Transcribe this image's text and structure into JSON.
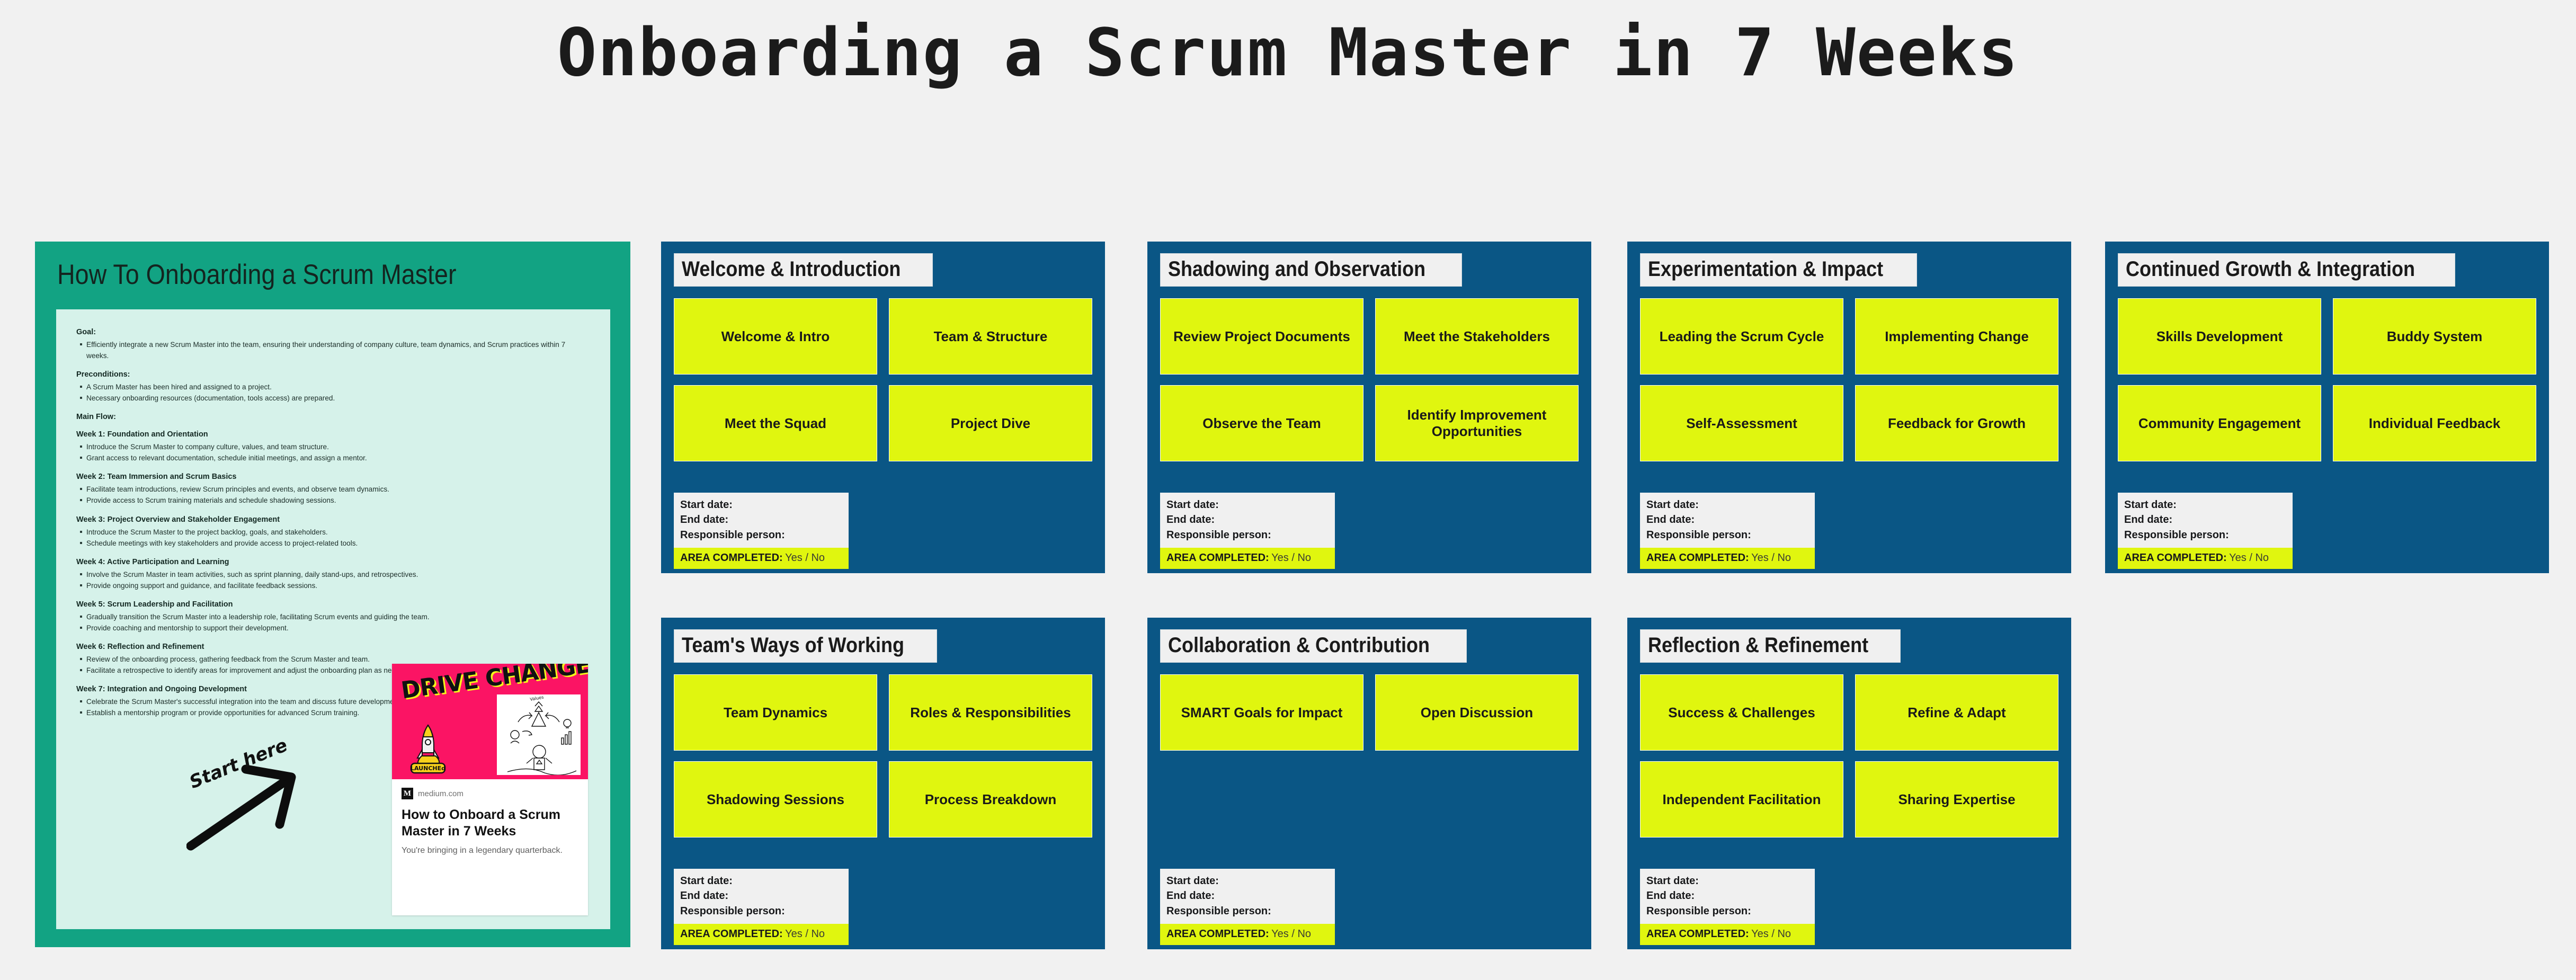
{
  "page": {
    "title": "Onboarding a Scrum Master in 7 Weeks",
    "background_color": "#f1f1f1"
  },
  "colors": {
    "teal": "#12a383",
    "mint": "#d6f2ea",
    "blue": "#0a5685",
    "yellow": "#e0f60f",
    "pink": "#fb1464"
  },
  "doc_panel": {
    "header_title": "How To Onboarding a Scrum Master",
    "sections": [
      {
        "heading": "Goal:",
        "items": [
          "Efficiently integrate a new Scrum Master into the team, ensuring their understanding of company culture, team dynamics, and Scrum practices within 7 weeks."
        ]
      },
      {
        "heading": "Preconditions:",
        "items": [
          "A Scrum Master has been hired and assigned to a project.",
          "Necessary onboarding resources (documentation, tools access) are prepared."
        ]
      },
      {
        "heading": "Main Flow:",
        "items": []
      },
      {
        "heading": "Week 1: Foundation and Orientation",
        "items": [
          "Introduce the Scrum Master to company culture, values, and team structure.",
          "Grant access to relevant documentation, schedule initial meetings, and assign a mentor."
        ]
      },
      {
        "heading": "Week 2: Team Immersion and Scrum Basics",
        "items": [
          "Facilitate team introductions, review Scrum principles and events, and observe team dynamics.",
          "Provide access to Scrum training materials and schedule shadowing sessions."
        ]
      },
      {
        "heading": "Week 3: Project Overview and Stakeholder Engagement",
        "items": [
          "Introduce the Scrum Master to the project backlog, goals, and stakeholders.",
          "Schedule meetings with key stakeholders and provide access to project-related tools."
        ]
      },
      {
        "heading": "Week 4: Active Participation and Learning",
        "items": [
          "Involve the Scrum Master in team activities, such as sprint planning, daily stand-ups, and retrospectives.",
          "Provide ongoing support and guidance, and facilitate feedback sessions."
        ]
      },
      {
        "heading": "Week 5: Scrum Leadership and Facilitation",
        "items": [
          "Gradually transition the Scrum Master into a leadership role, facilitating Scrum events and guiding the team.",
          "Provide coaching and mentorship to support their development."
        ]
      },
      {
        "heading": "Week 6: Reflection and Refinement",
        "items": [
          "Review of the onboarding process, gathering feedback from the Scrum Master and team.",
          "Facilitate a retrospective to identify areas for improvement and adjust the onboarding plan as needed."
        ]
      },
      {
        "heading": "Week 7: Integration and Ongoing Development",
        "items": [
          "Celebrate the Scrum Master's successful integration into the team and discuss future development goals.",
          "Establish a mentorship program or provide opportunities for advanced Scrum training."
        ]
      }
    ]
  },
  "annotation": {
    "start_here_label": "Start here"
  },
  "preview_card": {
    "hero_title": "DRIVE CHANGE",
    "rocket_badge": "LAUNCHEd",
    "sketch_caption": "Values",
    "source_badge": "M",
    "source_name": "medium.com",
    "title": "How to Onboard a Scrum Master in 7 Weeks",
    "description": "You're bringing in a legendary quarterback."
  },
  "meta_labels": {
    "start_date": "Start date:",
    "end_date": "End date:",
    "responsible_person": "Responsible person:",
    "area_completed_label": "AREA COMPLETED:",
    "area_completed_value": "Yes / No"
  },
  "area_cards": [
    {
      "title": "Welcome & Introduction",
      "tiles": [
        "Welcome & Intro",
        "Team & Structure",
        "Meet the Squad",
        "Project Dive"
      ]
    },
    {
      "title": "Shadowing and Observation",
      "tiles": [
        "Review Project Documents",
        "Meet the Stakeholders",
        "Observe the Team",
        "Identify Improvement Opportunities"
      ]
    },
    {
      "title": "Experimentation & Impact",
      "tiles": [
        "Leading the Scrum Cycle",
        "Implementing Change",
        "Self-Assessment",
        "Feedback for Growth"
      ]
    },
    {
      "title": "Continued Growth & Integration",
      "tiles": [
        "Skills Development",
        "Buddy System",
        "Community Engagement",
        "Individual Feedback"
      ]
    },
    {
      "title": "Team's Ways of Working",
      "tiles": [
        "Team Dynamics",
        "Roles & Responsibilities",
        "Shadowing Sessions",
        "Process Breakdown"
      ]
    },
    {
      "title": "Collaboration & Contribution",
      "tiles": [
        "SMART Goals for Impact",
        "Open Discussion"
      ]
    },
    {
      "title": "Reflection & Refinement",
      "tiles": [
        "Success & Challenges",
        "Refine & Adapt",
        "Independent Facilitation",
        "Sharing Expertise"
      ]
    }
  ]
}
